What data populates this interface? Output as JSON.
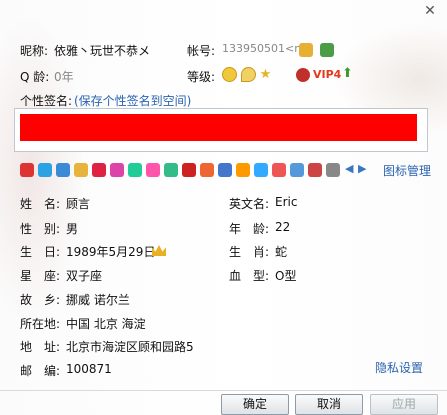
{
  "header": {
    "nickname_label": "昵称:",
    "nickname_value": "依雅丶玩世不恭メ",
    "account_label": "帐号:",
    "account_value": "133950501<n",
    "qage_label": "Q 龄:",
    "qage_value": "0年",
    "level_label": "等级:",
    "vip_label": "VIP4"
  },
  "signature": {
    "label": "个性签名:",
    "save_link": "(保存个性签名到空间)"
  },
  "icons": {
    "manage_link": "图标管理",
    "count": 18,
    "colors": [
      "#d33",
      "#2aa2e4",
      "#3a8ad6",
      "#e7b33c",
      "#d24",
      "#d4a",
      "#2c9",
      "#f5a",
      "#3b8",
      "#c22",
      "#e63",
      "#47c",
      "#f90",
      "#3af",
      "#e55",
      "#59d",
      "#c44",
      "#888"
    ]
  },
  "profile": {
    "name_label": "姓　名:",
    "name_value": "顾言",
    "english_label": "英文名:",
    "english_value": "Eric",
    "gender_label": "性　别:",
    "gender_value": "男",
    "age_label": "年　龄:",
    "age_value": "22",
    "birthday_label": "生　日:",
    "birthday_value": "1989年5月29日",
    "zodiac_label": "生　肖:",
    "zodiac_value": "蛇",
    "star_label": "星　座:",
    "star_value": "双子座",
    "blood_label": "血　型:",
    "blood_value": "O型",
    "hometown_label": "故　乡:",
    "hometown_value": "挪威 诺尔兰",
    "location_label": "所在地:",
    "location_value": "中国 北京 海淀",
    "address_label": "地　址:",
    "address_value": "北京市海淀区顾和园路5",
    "zip_label": "邮　编:",
    "zip_value": "100871",
    "privacy_link": "隐私设置"
  },
  "buttons": {
    "ok": "确定",
    "cancel": "取消",
    "apply": "应用"
  }
}
